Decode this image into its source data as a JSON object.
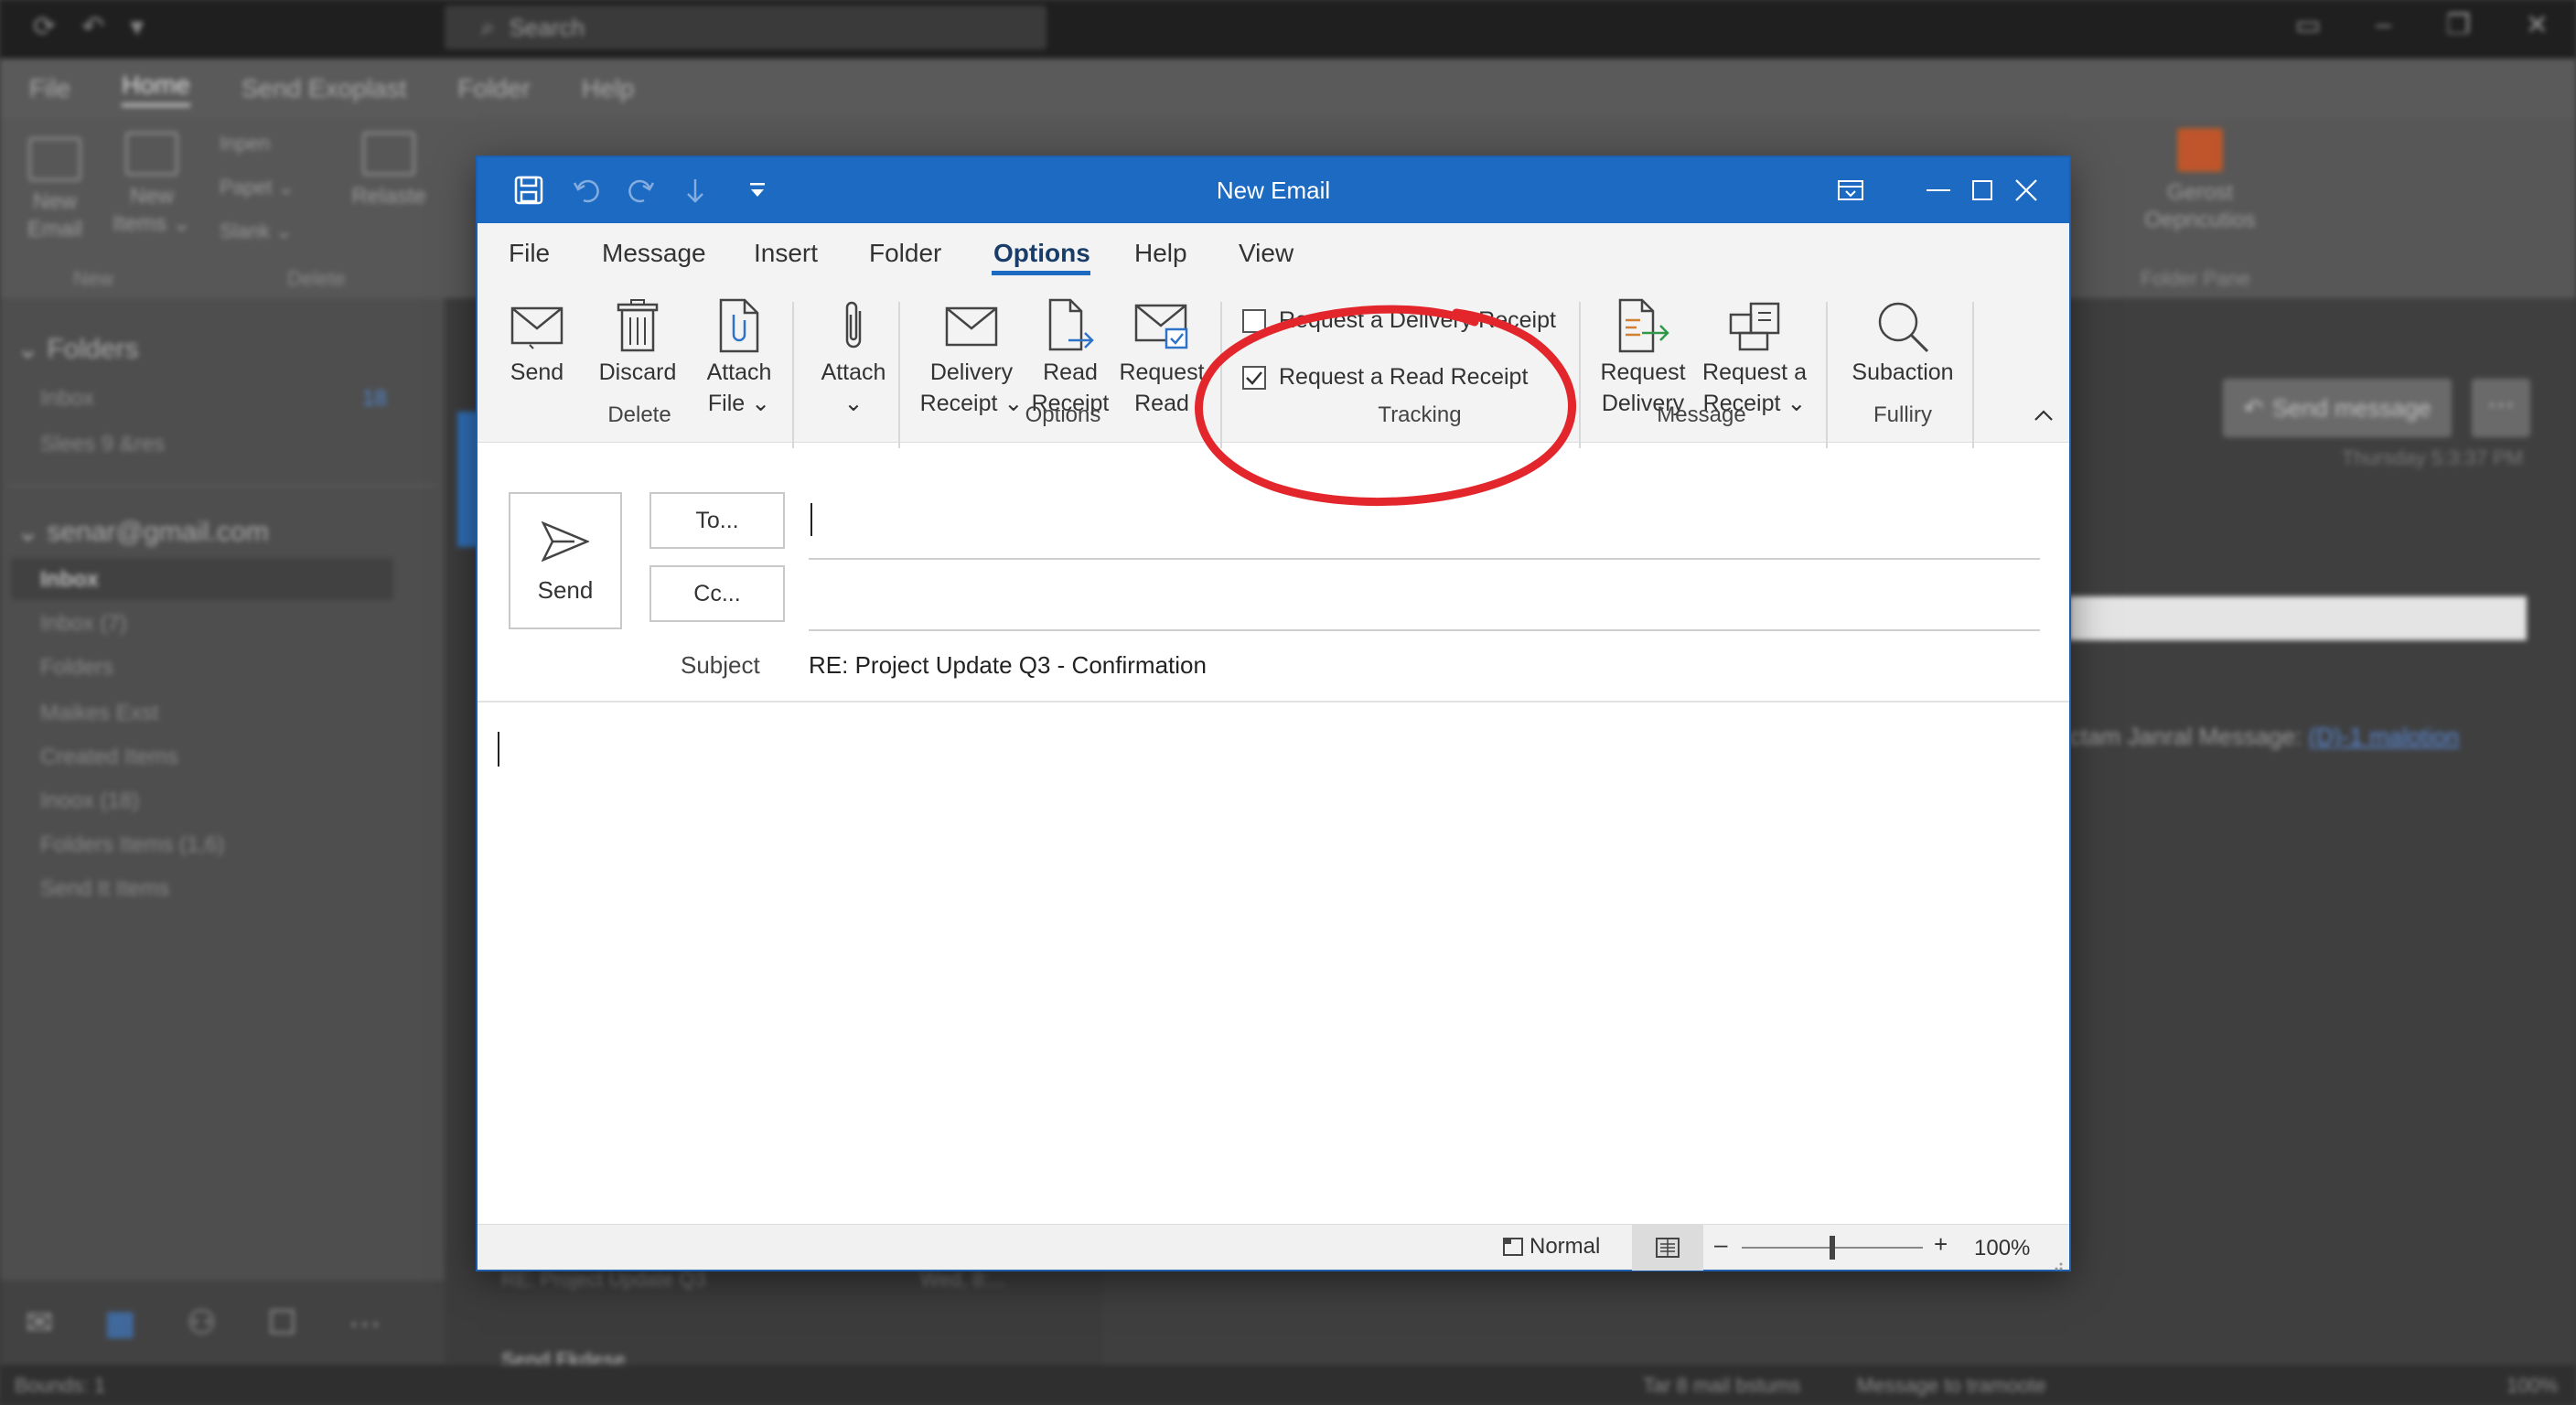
{
  "background": {
    "search_placeholder": "Search",
    "menu_tabs": [
      "File",
      "Home",
      "Send Exoplast",
      "Folder",
      "Help"
    ],
    "ribbon": {
      "new_email": "New\nEmail",
      "new_items": "New\nItems ⌄",
      "small_1": "Inpen",
      "small_2": "Papet ⌄",
      "small_3": "Slank ⌄",
      "relaste": "Relaste",
      "group_new": "New",
      "group_delete": "Delete",
      "gerost": "Gerost\nOepncutios",
      "folder_pane": "Folder Pane"
    },
    "sidebar": {
      "folders_head": "Folders",
      "inbox": "Inbox",
      "inbox_count": "18",
      "slees": "Slees 9 &res",
      "account": "senar@gmail.com",
      "items": [
        "Inbox",
        "Inbox (7)",
        "Folders",
        "Maikes Exst",
        "Created Items",
        "Inoox (18)",
        "Folders Items (1,6)",
        "Send It Items"
      ]
    },
    "mid": {
      "row1": "RE: Project Update Q3",
      "row1_time": "Wed, 8:...",
      "section": "Send Fkdese"
    },
    "reading": {
      "send_message": "Send message",
      "timestamp": "Thursday 5:3:37 PM",
      "auto_text": "ctam Janral Message:",
      "auto_link": "(D)-1 malotion"
    },
    "status": {
      "left": "Bounds: 1",
      "mid1": "Tar 8 mail bstums",
      "mid2": "Message to tramoote",
      "zoom": "100%"
    }
  },
  "dialog": {
    "title": "New Email",
    "menu_tabs": [
      "File",
      "Message",
      "Insert",
      "Folder",
      "Options",
      "Help",
      "View"
    ],
    "active_tab": "Options",
    "ribbon": {
      "send": "Send",
      "discard": "Discard",
      "attach_file_1": "Attach",
      "attach_file_2": "File ⌄",
      "attach": "Attach",
      "attach_chevron": "⌄",
      "delivery_receipt_1": "Delivery",
      "delivery_receipt_2": "Receipt ⌄",
      "read_receipt_1": "Read",
      "read_receipt_2": "Receipt",
      "request_read_1": "Request",
      "request_read_2": "Read",
      "chk_delivery": "Request a Delivery Receipt",
      "chk_delivery_checked": false,
      "chk_read": "Request a Read Receipt",
      "chk_read_checked": true,
      "request_delivery_1": "Request",
      "request_delivery_2": "Delivery",
      "request_receipt_1": "Request a",
      "request_receipt_2": "Receipt ⌄",
      "subaction": "Subaction",
      "groups": {
        "delete": "Delete",
        "options": "Options",
        "tracking": "Tracking",
        "message": "Message",
        "fulliry": "Fulliry"
      }
    },
    "compose": {
      "send": "Send",
      "to_button": "To...",
      "cc_button": "Cc...",
      "to_value": "",
      "cc_value": "",
      "subject_label": "Subject",
      "subject_value": "RE: Project Update Q3 - Confirmation",
      "body": ""
    },
    "status": {
      "view_mode": "Normal",
      "zoom": "100%",
      "zoom_level": 0.5
    }
  },
  "colors": {
    "title_blue": "#1d6ac3",
    "annotation_red": "#e3262c",
    "tab_underline": "#1d6ac3"
  }
}
